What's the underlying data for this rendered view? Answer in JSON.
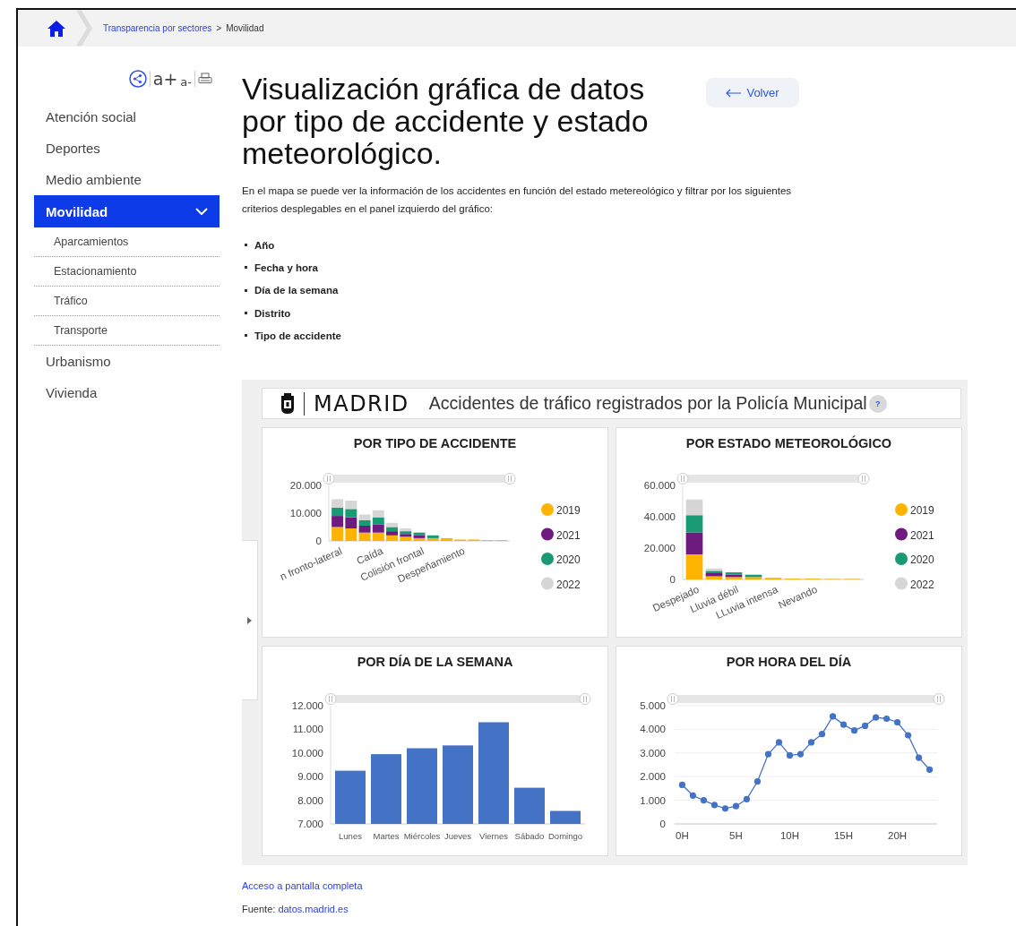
{
  "breadcrumb": {
    "items": [
      {
        "label": "Transparencia por sectores",
        "kind": "link"
      },
      {
        "label": "Movilidad",
        "kind": "current"
      }
    ],
    "separator": ">"
  },
  "tools": {
    "font_increase": "a+",
    "font_decrease": "a-"
  },
  "sidebar": {
    "items": [
      {
        "label": "Atención social",
        "selected": false,
        "expanded": false
      },
      {
        "label": "Deportes",
        "selected": false,
        "expanded": false
      },
      {
        "label": "Medio ambiente",
        "selected": false,
        "expanded": false
      },
      {
        "label": "Movilidad",
        "selected": true,
        "expanded": true,
        "children": [
          {
            "label": "Aparcamientos",
            "selected": false
          },
          {
            "label": "Estacionamiento",
            "selected": false
          },
          {
            "label": "Tráfico",
            "selected": false
          },
          {
            "label": "Transporte",
            "selected": false
          }
        ]
      },
      {
        "label": "Urbanismo",
        "selected": false,
        "expanded": false
      },
      {
        "label": "Vivienda",
        "selected": false,
        "expanded": false
      }
    ]
  },
  "title": "Visualización gráfica de datos por tipo de accidente y estado meteorológico.",
  "back_button": "Volver",
  "description": "En el mapa se puede ver la información de los accidentes en función del estado metereológico y filtrar por los siguientes criterios desplegables en el panel izquierdo del gráfico:",
  "criteria": [
    "Año",
    "Fecha y hora",
    "Día de la semana",
    "Distrito",
    "Tipo de accidente"
  ],
  "dashboard": {
    "logo_text": "MADRID",
    "title": "Accidentes de tráfico registrados por la Policía Municipal",
    "help": "?",
    "panels": [
      {
        "title": "POR TIPO DE ACCIDENTE",
        "chart_data": {
          "type": "bar",
          "stacked": true,
          "categories": [
            "n fronto-lateral",
            null,
            null,
            "Caída",
            null,
            null,
            "Colisión frontal",
            null,
            null,
            "Despeñamiento",
            null,
            null,
            null
          ],
          "ylim": [
            0,
            20000
          ],
          "yticks": [
            {
              "value": 0,
              "label": "0"
            },
            {
              "value": 10000,
              "label": "10.000"
            },
            {
              "value": 20000,
              "label": "20.000"
            }
          ],
          "series": [
            {
              "name": "2019",
              "color": "#fdb300",
              "values": [
                5000,
                4500,
                3000,
                3000,
                2000,
                1500,
                1000,
                1000,
                1000,
                500,
                500,
                300,
                300
              ]
            },
            {
              "name": "2021",
              "color": "#6e1a7e",
              "values": [
                4000,
                4000,
                2500,
                3000,
                1500,
                1000,
                1000,
                0,
                0,
                0,
                0,
                0,
                0
              ]
            },
            {
              "name": "2020",
              "color": "#1a9a74",
              "values": [
                3000,
                3000,
                2000,
                2500,
                1500,
                1000,
                1000,
                1000,
                0,
                0,
                0,
                0,
                0
              ]
            },
            {
              "name": "2022",
              "color": "#d6d6d6",
              "values": [
                3000,
                3000,
                2000,
                2500,
                1500,
                1000,
                0,
                0,
                0,
                0,
                0,
                0,
                0
              ]
            }
          ],
          "legend": true
        }
      },
      {
        "title": "POR ESTADO METEOROLÓGICO",
        "chart_data": {
          "type": "bar",
          "stacked": true,
          "categories": [
            "Despejado",
            null,
            "Lluvia débil",
            null,
            "LLuvia intensa",
            null,
            "Nevando",
            null,
            null
          ],
          "ylim": [
            0,
            60000
          ],
          "yticks": [
            {
              "value": 0,
              "label": "0"
            },
            {
              "value": 20000,
              "label": "20.000"
            },
            {
              "value": 40000,
              "label": "40.000"
            },
            {
              "value": 60000,
              "label": "60.000"
            }
          ],
          "series": [
            {
              "name": "2019",
              "color": "#fdb300",
              "values": [
                16000,
                2000,
                1500,
                1500,
                1000,
                500,
                500,
                300,
                300
              ]
            },
            {
              "name": "2021",
              "color": "#6e1a7e",
              "values": [
                14000,
                2000,
                1500,
                0,
                0,
                0,
                0,
                0,
                0
              ]
            },
            {
              "name": "2020",
              "color": "#1a9a74",
              "values": [
                11000,
                1500,
                1500,
                1500,
                0,
                0,
                0,
                0,
                0
              ]
            },
            {
              "name": "2022",
              "color": "#d6d6d6",
              "values": [
                10000,
                1500,
                0,
                0,
                0,
                0,
                0,
                0,
                0
              ]
            }
          ],
          "legend": true
        }
      },
      {
        "title": "POR DÍA DE LA SEMANA",
        "chart_data": {
          "type": "bar",
          "categories": [
            "Lunes",
            "Martes",
            "Miércoles",
            "Jueves",
            "Viernes",
            "Sábado",
            "Domingo"
          ],
          "ylim": [
            7000,
            12000
          ],
          "yticks": [
            {
              "value": 7000,
              "label": "7.000"
            },
            {
              "value": 8000,
              "label": "8.000"
            },
            {
              "value": 9000,
              "label": "9.000"
            },
            {
              "value": 10000,
              "label": "10.000"
            },
            {
              "value": 11000,
              "label": "11.000"
            },
            {
              "value": 12000,
              "label": "12.000"
            }
          ],
          "series": [
            {
              "color": "#4472c4",
              "values": [
                9250,
                9950,
                10200,
                10320,
                11300,
                8530,
                7550
              ]
            }
          ]
        }
      },
      {
        "title": "POR HORA DEL DÍA",
        "chart_data": {
          "type": "line",
          "x": [
            0,
            1,
            2,
            3,
            4,
            5,
            6,
            7,
            8,
            9,
            10,
            11,
            12,
            13,
            14,
            15,
            16,
            17,
            18,
            19,
            20,
            21,
            22,
            23
          ],
          "xlim": [
            -0.7,
            23.7
          ],
          "grid": true,
          "xticks": [
            {
              "value": 0,
              "label": "0H"
            },
            {
              "value": 5,
              "label": "5H"
            },
            {
              "value": 10,
              "label": "10H"
            },
            {
              "value": 15,
              "label": "15H"
            },
            {
              "value": 20,
              "label": "20H"
            }
          ],
          "ylim": [
            0,
            5000
          ],
          "yticks": [
            {
              "value": 0,
              "label": "0"
            },
            {
              "value": 1000,
              "label": "1.000"
            },
            {
              "value": 2000,
              "label": "2.000"
            },
            {
              "value": 3000,
              "label": "3.000"
            },
            {
              "value": 4000,
              "label": "4.000"
            },
            {
              "value": 5000,
              "label": "5.000"
            }
          ],
          "series": [
            {
              "color": "#4472c4",
              "marker": "circle",
              "values": [
                1650,
                1200,
                1000,
                800,
                650,
                750,
                1050,
                1800,
                2950,
                3450,
                2900,
                2950,
                3450,
                3800,
                4550,
                4200,
                3950,
                4150,
                4500,
                4450,
                4300,
                3750,
                2800,
                2300
              ]
            }
          ]
        }
      }
    ]
  },
  "fullscreen_link": "Acceso a pantalla completa",
  "source": {
    "label": "Fuente:",
    "link": "datos.madrid.es"
  }
}
